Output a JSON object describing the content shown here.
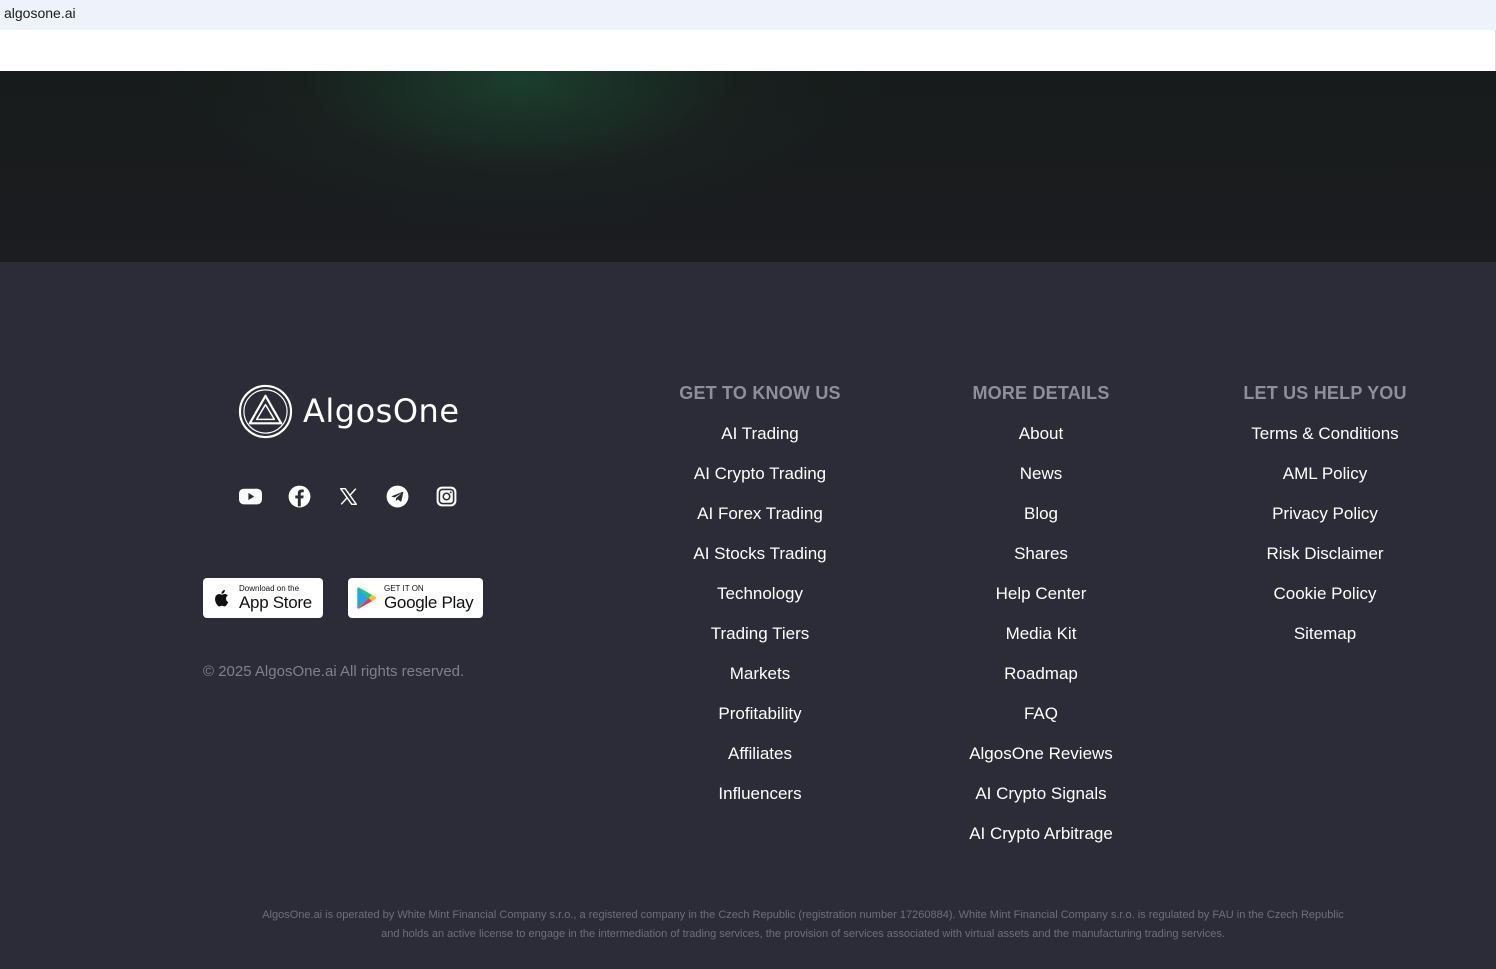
{
  "browser": {
    "url": "algosone.ai"
  },
  "brand": {
    "name": "AlgosOne",
    "logo_icon": "algosone-triangle-logo"
  },
  "socials": [
    {
      "icon": "youtube-icon"
    },
    {
      "icon": "facebook-icon"
    },
    {
      "icon": "x-twitter-icon"
    },
    {
      "icon": "telegram-icon"
    },
    {
      "icon": "instagram-icon"
    }
  ],
  "stores": {
    "app": {
      "small": "Download on the",
      "big": "App Store",
      "icon": "apple-icon"
    },
    "play": {
      "small": "GET IT ON",
      "big": "Google Play",
      "icon": "google-play-icon"
    }
  },
  "copyright": "© 2025 AlgosOne.ai All rights reserved.",
  "columns": [
    {
      "title": "GET TO KNOW US",
      "links": [
        "AI Trading",
        "AI Crypto Trading",
        "AI Forex Trading",
        "AI Stocks Trading",
        "Technology",
        "Trading Tiers",
        "Markets",
        "Profitability",
        "Affiliates",
        "Influencers"
      ]
    },
    {
      "title": "MORE DETAILS",
      "links": [
        "About",
        "News",
        "Blog",
        "Shares",
        "Help Center",
        "Media Kit",
        "Roadmap",
        "FAQ",
        "AlgosOne Reviews",
        "AI Crypto Signals",
        "AI Crypto Arbitrage"
      ]
    },
    {
      "title": "LET US HELP YOU",
      "links": [
        "Terms & Conditions",
        "AML Policy",
        "Privacy Policy",
        "Risk Disclaimer",
        "Cookie Policy",
        "Sitemap"
      ]
    }
  ],
  "legal": {
    "line1": "AlgosOne.ai is operated by White Mint Financial Company s.r.o., a registered company in the Czech Republic (registration number 17260884). White Mint Financial Company s.r.o. is regulated by FAU in the Czech Republic",
    "line2": "and holds an active license to engage in the intermediation of trading services, the provision of services associated with virtual assets and the manufacturing trading services."
  },
  "colors": {
    "footer_bg": "#2b2c37",
    "heading": "#8e8f9b",
    "link": "#ffffff",
    "muted": "#7f808c"
  }
}
